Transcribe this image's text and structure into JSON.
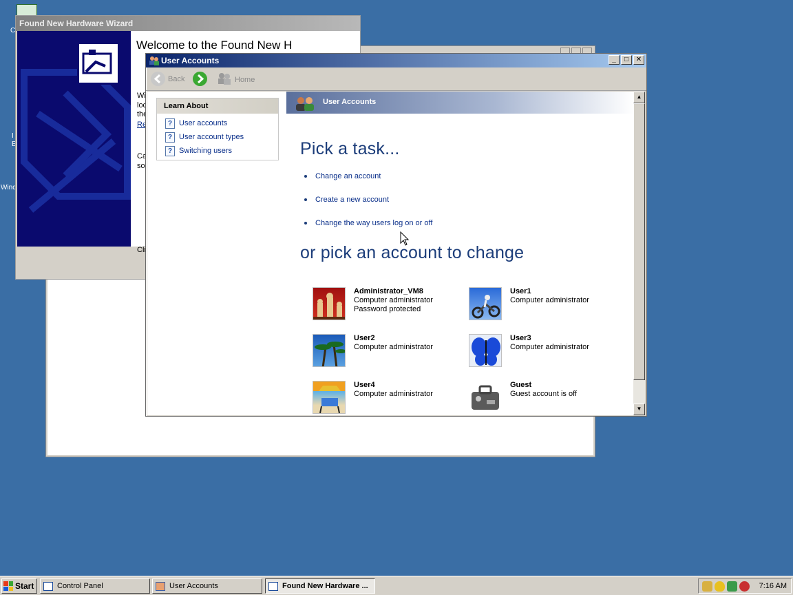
{
  "desktop": {
    "fragments": [
      "C",
      "I",
      "E",
      "Wind"
    ]
  },
  "hardware_wizard": {
    "title": "Found New Hardware Wizard",
    "heading": "Welcome to the Found New H",
    "fragments": [
      "Wi",
      "loc",
      "the",
      "Re",
      "Ca",
      "sol",
      "Cli"
    ]
  },
  "user_accounts": {
    "window_title": "User Accounts",
    "title_buttons": [
      "_",
      "□",
      "✕"
    ],
    "toolbar": {
      "back_label": "Back",
      "home_label": "Home"
    },
    "learn_about": {
      "heading": "Learn About",
      "items": [
        {
          "label": "User accounts"
        },
        {
          "label": "User account types"
        },
        {
          "label": "Switching users"
        }
      ]
    },
    "banner_title": "User Accounts",
    "pick_task": "Pick a task...",
    "tasks": [
      {
        "label": "Change an account"
      },
      {
        "label": "Create a new account"
      },
      {
        "label": "Change the way users log on or off"
      }
    ],
    "pick_account": "or pick an account to change",
    "accounts": [
      {
        "name": "Administrator_VM8",
        "type": "Computer administrator",
        "extra": "Password protected",
        "picture": "chess"
      },
      {
        "name": "User1",
        "type": "Computer administrator",
        "extra": "",
        "picture": "dirt-bike"
      },
      {
        "name": "User2",
        "type": "Computer administrator",
        "extra": "",
        "picture": "palm-trees"
      },
      {
        "name": "User3",
        "type": "Computer administrator",
        "extra": "",
        "picture": "butterfly"
      },
      {
        "name": "User4",
        "type": "Computer administrator",
        "extra": "",
        "picture": "beach-chair"
      },
      {
        "name": "Guest",
        "type": "Guest account is off",
        "extra": "",
        "picture": "suitcase"
      }
    ]
  },
  "taskbar": {
    "start_label": "Start",
    "buttons": [
      {
        "label": "Control Panel",
        "active": false
      },
      {
        "label": "User Accounts",
        "active": false
      },
      {
        "label": "Found New Hardware ...",
        "active": true
      }
    ],
    "clock": "7:16 AM"
  },
  "colors": {
    "desktop": "#3a6ea5",
    "title_active": "#0a246a",
    "link": "#0a2f8a",
    "heading": "#1c3d7a"
  }
}
